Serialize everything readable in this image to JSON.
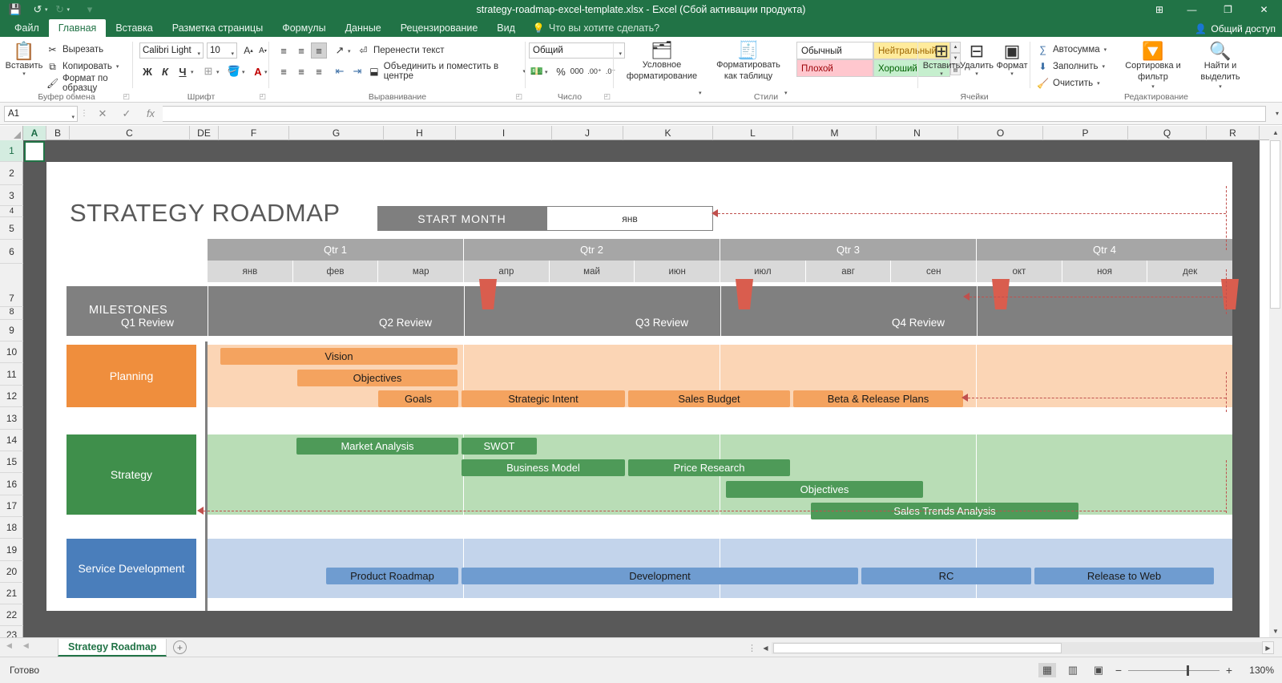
{
  "window": {
    "title": "strategy-roadmap-excel-template.xlsx - Excel (Сбой активации продукта)",
    "minimize": "—",
    "restore": "❐",
    "close": "✕",
    "ribbon_display_options": "⊞",
    "qat": {
      "save": "💾",
      "undo": "↺",
      "redo": "↻",
      "customize": "▾"
    }
  },
  "ribbon": {
    "tabs": [
      {
        "label": "Файл",
        "active": false
      },
      {
        "label": "Главная",
        "active": true
      },
      {
        "label": "Вставка",
        "active": false
      },
      {
        "label": "Разметка страницы",
        "active": false
      },
      {
        "label": "Формулы",
        "active": false
      },
      {
        "label": "Данные",
        "active": false
      },
      {
        "label": "Рецензирование",
        "active": false
      },
      {
        "label": "Вид",
        "active": false
      }
    ],
    "tellme": "Что вы хотите сделать?",
    "share": "Общий доступ",
    "groups": {
      "clipboard": {
        "name": "Буфер обмена",
        "paste": "Вставить",
        "cut": "Вырезать",
        "copy": "Копировать",
        "format_painter": "Формат по образцу"
      },
      "font": {
        "name": "Шрифт",
        "font_name": "Calibri Light",
        "font_size": "10",
        "grow": "A",
        "shrink": "A",
        "bold": "Ж",
        "italic": "К",
        "underline": "Ч",
        "borders": "⊞",
        "fill": "🎨",
        "color": "A"
      },
      "alignment": {
        "name": "Выравнивание",
        "wrap_text": "Перенести текст",
        "merge_center": "Объединить и поместить в центре"
      },
      "number": {
        "name": "Число",
        "format": "Общий",
        "currency": "¤",
        "percent": "%",
        "thousands": "000",
        "inc_dec": ".00",
        "dec_dec": ".00"
      },
      "styles": {
        "name": "Стили",
        "conditional": "Условное форматирование",
        "as_table": "Форматировать как таблицу",
        "cells": [
          {
            "label": "Обычный",
            "kind": "normal"
          },
          {
            "label": "Нейтральный",
            "kind": "neutral"
          },
          {
            "label": "Плохой",
            "kind": "bad"
          },
          {
            "label": "Хороший",
            "kind": "good"
          }
        ]
      },
      "cells": {
        "name": "Ячейки",
        "insert": "Вставить",
        "delete": "Удалить",
        "format": "Формат"
      },
      "editing": {
        "name": "Редактирование",
        "autosum": "Автосумма",
        "fill": "Заполнить",
        "clear": "Очистить",
        "sort_filter": "Сортировка и фильтр",
        "find_select": "Найти и выделить"
      }
    }
  },
  "formula_bar": {
    "name_box": "A1",
    "cancel": "✕",
    "enter": "✓",
    "insert_function": "fx",
    "value": "",
    "expand": "▾"
  },
  "grid": {
    "columns": [
      "A",
      "B",
      "C",
      "DE",
      "F",
      "G",
      "H",
      "I",
      "J",
      "K",
      "L",
      "M",
      "N",
      "O",
      "P",
      "Q",
      "R"
    ],
    "rows": [
      "1",
      "2",
      "3",
      "4",
      "5",
      "6",
      "7",
      "8",
      "9",
      "10",
      "11",
      "12",
      "13",
      "14",
      "15",
      "16",
      "17",
      "18",
      "19",
      "20",
      "21",
      "22",
      "23"
    ],
    "selected_cell": "A1",
    "selected_column": "A",
    "selected_row": "1"
  },
  "roadmap": {
    "title": "STRATEGY ROADMAP",
    "start_month_label": "START MONTH",
    "start_month_value": "янв",
    "quarters": [
      "Qtr 1",
      "Qtr 2",
      "Qtr 3",
      "Qtr 4"
    ],
    "months": [
      "янв",
      "фев",
      "мар",
      "апр",
      "май",
      "июн",
      "июл",
      "авг",
      "сен",
      "окт",
      "ноя",
      "дек"
    ],
    "milestones_label": "MILESTONES",
    "milestones": [
      {
        "label": "Q1 Review",
        "month_index": 3
      },
      {
        "label": "Q2 Review",
        "month_index": 6
      },
      {
        "label": "Q3 Review",
        "month_index": 9
      },
      {
        "label": "Q4 Review",
        "month_index": 12
      }
    ],
    "categories": [
      {
        "name": "Planning",
        "color": "#ef8e3d",
        "band_color": "#fbd5b5",
        "tasks": [
          {
            "label": "Vision",
            "start": 0.7,
            "end": 3.5,
            "lane": 0
          },
          {
            "label": "Objectives",
            "start": 1.6,
            "end": 3.5,
            "lane": 1
          },
          {
            "label": "Goals",
            "start": 2.55,
            "end": 3.5,
            "lane": 2
          },
          {
            "label": "Strategic Intent",
            "start": 3.55,
            "end": 5.45,
            "lane": 2
          },
          {
            "label": "Sales Budget",
            "start": 5.5,
            "end": 7.4,
            "lane": 2
          },
          {
            "label": "Beta & Release Plans",
            "start": 7.45,
            "end": 9.35,
            "lane": 2
          }
        ]
      },
      {
        "name": "Strategy",
        "color": "#3f8f4b",
        "band_color": "#b9ddb6",
        "tasks": [
          {
            "label": "Market Analysis",
            "start": 1.6,
            "end": 3.5,
            "lane": 0
          },
          {
            "label": "SWOT",
            "start": 3.55,
            "end": 4.45,
            "lane": 0
          },
          {
            "label": "Business Model",
            "start": 3.55,
            "end": 5.45,
            "lane": 1
          },
          {
            "label": "Price Research",
            "start": 5.5,
            "end": 7.4,
            "lane": 1
          },
          {
            "label": "Objectives",
            "start": 6.65,
            "end": 8.85,
            "lane": 2
          },
          {
            "label": "Sales Trends Analysis",
            "start": 7.65,
            "end": 10.8,
            "lane": 3
          }
        ]
      },
      {
        "name": "Service Development",
        "color": "#4a7ebb",
        "band_color": "#c3d4eb",
        "tasks": [
          {
            "label": "Product Roadmap",
            "start": 1.95,
            "end": 3.5,
            "lane": 0
          },
          {
            "label": "Development",
            "start": 3.55,
            "end": 8.2,
            "lane": 0
          },
          {
            "label": "RC",
            "start": 8.25,
            "end": 10.25,
            "lane": 0
          },
          {
            "label": "Release to Web",
            "start": 10.3,
            "end": 12.0,
            "lane": 0
          }
        ]
      }
    ]
  },
  "sheet_tabs": {
    "first": "◀◀",
    "prev": "◀",
    "tabs": [
      {
        "label": "Strategy Roadmap",
        "active": true
      }
    ],
    "add": "+"
  },
  "status_bar": {
    "status": "Готово",
    "views": [
      {
        "name": "normal-view",
        "glyph": "▦",
        "active": true
      },
      {
        "name": "page-layout-view",
        "glyph": "▥",
        "active": false
      },
      {
        "name": "page-break-view",
        "glyph": "▣",
        "active": false
      }
    ],
    "zoom_out": "−",
    "zoom_in": "+",
    "zoom_level": "130%"
  }
}
